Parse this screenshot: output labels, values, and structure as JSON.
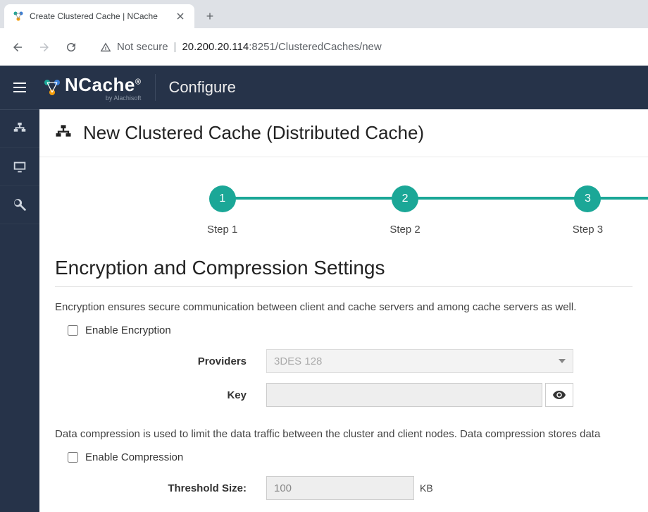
{
  "browser": {
    "tab_title": "Create Clustered Cache | NCache",
    "not_secure": "Not secure",
    "host": "20.200.20.114",
    "port_path": ":8251/ClusteredCaches/new"
  },
  "header": {
    "brand": "NCache",
    "brand_sub": "by Alachisoft",
    "section": "Configure"
  },
  "page": {
    "title": "New Clustered Cache (Distributed Cache)"
  },
  "stepper": {
    "steps": [
      {
        "num": "1",
        "label": "Step 1"
      },
      {
        "num": "2",
        "label": "Step 2"
      },
      {
        "num": "3",
        "label": "Step 3"
      }
    ]
  },
  "section": {
    "title": "Encryption and Compression Settings",
    "encryption_desc": "Encryption ensures secure communication between client and cache servers and among cache servers as well.",
    "enable_encryption": "Enable Encryption",
    "providers_label": "Providers",
    "providers_value": "3DES 128",
    "key_label": "Key",
    "key_value": "",
    "compression_desc": "Data compression is used to limit the data traffic between the cluster and client nodes. Data compression stores data",
    "enable_compression": "Enable Compression",
    "threshold_label": "Threshold Size:",
    "threshold_value": "100",
    "threshold_unit": "KB"
  }
}
